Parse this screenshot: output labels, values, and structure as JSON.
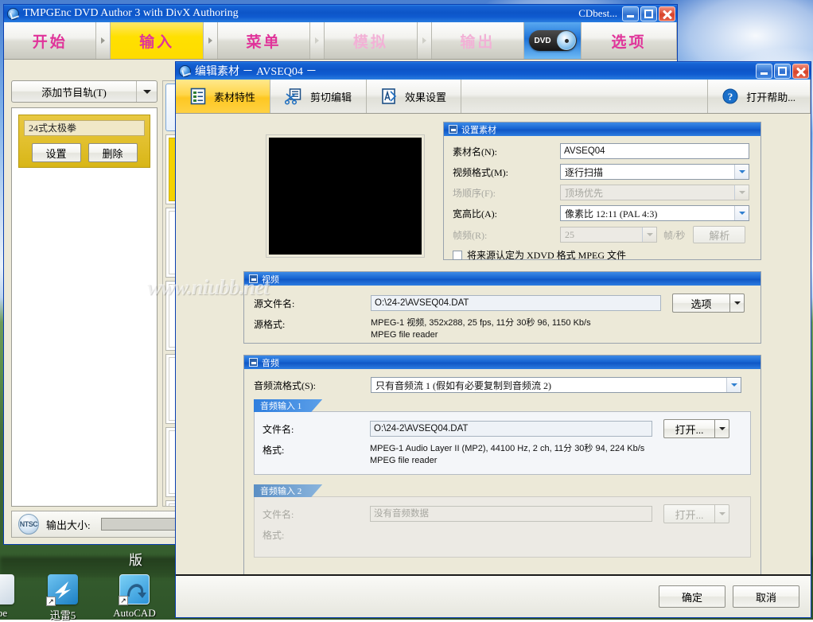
{
  "desktop": {
    "version_text": "版",
    "icons": [
      {
        "label": "ribe",
        "name": "desktop-icon-ribe",
        "color": "#dfe8ef"
      },
      {
        "label": "迅雷5",
        "name": "desktop-icon-xunlei5",
        "color": "#2f9fe0"
      },
      {
        "label": "AutoCAD",
        "name": "desktop-icon-autocad",
        "color": "#3aa7e8"
      }
    ],
    "shortcut_glyph": "↗"
  },
  "main_window": {
    "title": "TMPGEnc DVD Author 3 with DivX Authoring",
    "extra_title": "CDbest...",
    "tabs": [
      {
        "label": "开始",
        "state": "normal"
      },
      {
        "label": "输入",
        "state": "active"
      },
      {
        "label": "菜单",
        "state": "normal"
      },
      {
        "label": "模拟",
        "state": "dim"
      },
      {
        "label": "输出",
        "state": "dim"
      }
    ],
    "dvd_badge": "DVD",
    "options_tab": "选项",
    "sidebar": {
      "add_track_label": "添加节目轨(T)",
      "track": {
        "name": "24式太极拳",
        "settings_label": "设置",
        "delete_label": "删除"
      }
    },
    "status": {
      "badge": "NTSC",
      "label": "输出大小:"
    }
  },
  "dialog": {
    "title": "编辑素材 － AVSEQ04 －",
    "tabs": [
      {
        "label": "素材特性",
        "icon": "document-list-icon",
        "state": "active"
      },
      {
        "label": "剪切编辑",
        "icon": "scissors-icon",
        "state": "normal"
      },
      {
        "label": "效果设置",
        "icon": "effects-icon",
        "state": "normal"
      }
    ],
    "help_label": "打开帮助...",
    "help_icon": "question-circle-icon",
    "clip_settings": {
      "group_title": "设置素材",
      "name_label": "素材名(N):",
      "name_value": "AVSEQ04",
      "video_format_label": "视频格式(M):",
      "video_format_value": "逐行扫描",
      "field_order_label": "场顺序(F):",
      "field_order_value": "顶场优先",
      "aspect_label": "宽高比(A):",
      "aspect_value": "像素比 12:11 (PAL 4:3)",
      "framerate_label": "帧频(R):",
      "framerate_value": "25",
      "framerate_unit": "帧/秒",
      "analyze_label": "解析",
      "xdvd_checkbox_label": "将来源认定为 XDVD 格式 MPEG 文件",
      "xdvd_checked": false
    },
    "video": {
      "group_title": "视频",
      "source_file_label": "源文件名:",
      "source_file_value": "O:\\24-2\\AVSEQ04.DAT",
      "options_button": "选项",
      "source_format_label": "源格式:",
      "source_format_line1": "MPEG-1 视频, 352x288, 25 fps, 11分 30秒 96, 1150 Kb/s",
      "source_format_line2": "MPEG file reader"
    },
    "audio": {
      "group_title": "音频",
      "stream_format_label": "音频流格式(S):",
      "stream_format_value": "只有音频流 1 (假如有必要复制到音频流 2)",
      "input1": {
        "tab_label": "音频输入 1",
        "file_label": "文件名:",
        "file_value": "O:\\24-2\\AVSEQ04.DAT",
        "open_button": "打开...",
        "format_label": "格式:",
        "format_line1": "MPEG-1 Audio Layer II (MP2), 44100 Hz, 2 ch, 11分 30秒 94, 224 Kb/s",
        "format_line2": "MPEG file reader"
      },
      "input2": {
        "tab_label": "音频输入 2",
        "file_label": "文件名:",
        "file_placeholder": "没有音频数据",
        "open_button": "打开...",
        "format_label": "格式:"
      }
    },
    "footer": {
      "ok_label": "确定",
      "cancel_label": "取消"
    }
  },
  "watermark": "www.niubb.net",
  "colors": {
    "title_blue": "#0d55c8",
    "tab_yellow": "#ffdb00",
    "tab_pink": "#e0349a",
    "group_header_blue": "#1765d2",
    "size_bar_magenta": "#cc54cc"
  }
}
